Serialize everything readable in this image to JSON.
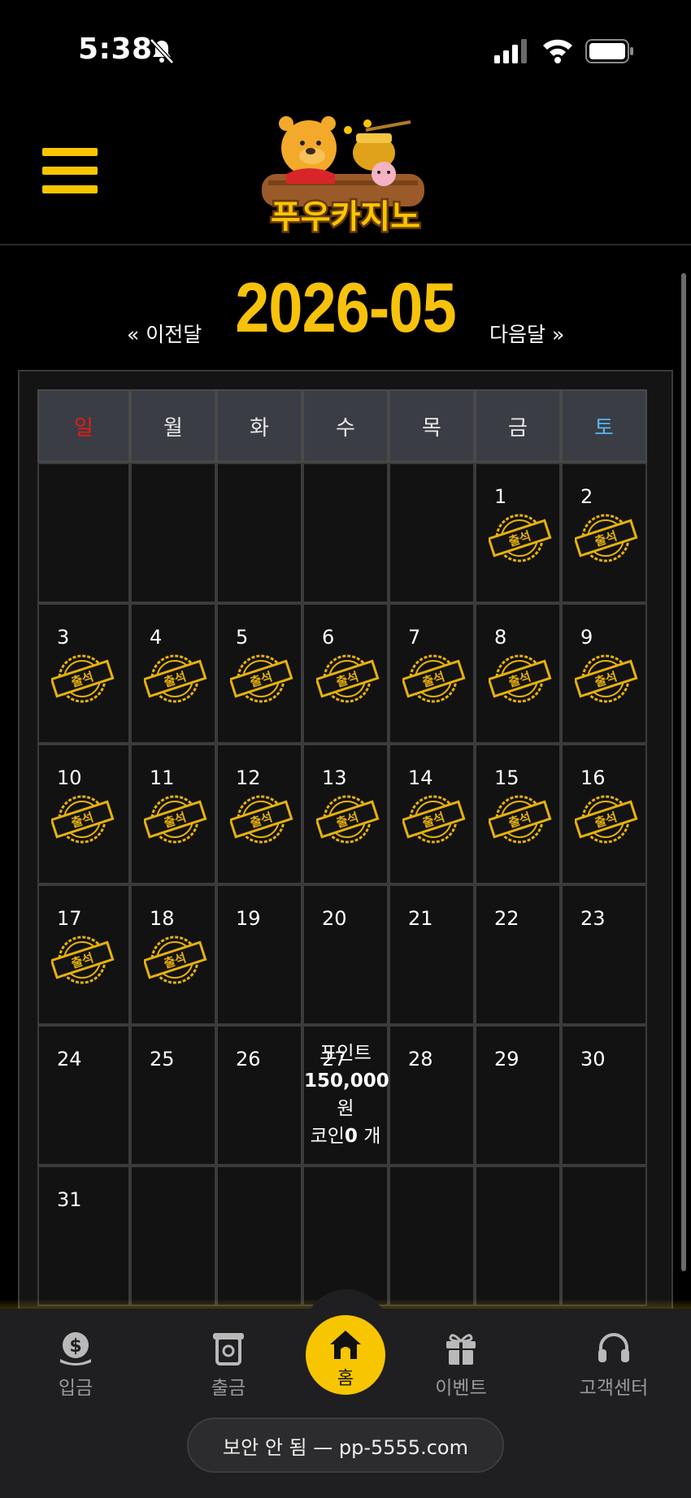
{
  "status_bar": {
    "time": "5:38"
  },
  "header": {
    "logo_text": "푸우카지노"
  },
  "month_nav": {
    "prev": "« 이전달",
    "title": "2026-05",
    "next": "다음달 »"
  },
  "calendar": {
    "weekdays": [
      "일",
      "월",
      "화",
      "수",
      "목",
      "금",
      "토"
    ],
    "weeks": [
      [
        {
          "day": "",
          "stamp": false
        },
        {
          "day": "",
          "stamp": false
        },
        {
          "day": "",
          "stamp": false
        },
        {
          "day": "",
          "stamp": false
        },
        {
          "day": "",
          "stamp": false
        },
        {
          "day": "1",
          "stamp": true
        },
        {
          "day": "2",
          "stamp": true
        }
      ],
      [
        {
          "day": "3",
          "stamp": true
        },
        {
          "day": "4",
          "stamp": true
        },
        {
          "day": "5",
          "stamp": true
        },
        {
          "day": "6",
          "stamp": true
        },
        {
          "day": "7",
          "stamp": true
        },
        {
          "day": "8",
          "stamp": true
        },
        {
          "day": "9",
          "stamp": true
        }
      ],
      [
        {
          "day": "10",
          "stamp": true
        },
        {
          "day": "11",
          "stamp": true
        },
        {
          "day": "12",
          "stamp": true
        },
        {
          "day": "13",
          "stamp": true
        },
        {
          "day": "14",
          "stamp": true
        },
        {
          "day": "15",
          "stamp": true
        },
        {
          "day": "16",
          "stamp": true
        }
      ],
      [
        {
          "day": "17",
          "stamp": true
        },
        {
          "day": "18",
          "stamp": true
        },
        {
          "day": "19",
          "stamp": false
        },
        {
          "day": "20",
          "stamp": false
        },
        {
          "day": "21",
          "stamp": false
        },
        {
          "day": "22",
          "stamp": false
        },
        {
          "day": "23",
          "stamp": false
        }
      ],
      [
        {
          "day": "24",
          "stamp": false
        },
        {
          "day": "25",
          "stamp": false
        },
        {
          "day": "26",
          "stamp": false
        },
        {
          "day": "27",
          "stamp": false
        },
        {
          "day": "28",
          "stamp": false
        },
        {
          "day": "29",
          "stamp": false
        },
        {
          "day": "30",
          "stamp": false
        }
      ],
      [
        {
          "day": "31",
          "stamp": false
        },
        {
          "day": "",
          "stamp": false
        },
        {
          "day": "",
          "stamp": false
        },
        {
          "day": "",
          "stamp": false
        },
        {
          "day": "",
          "stamp": false
        },
        {
          "day": "",
          "stamp": false
        },
        {
          "day": "",
          "stamp": false
        }
      ]
    ],
    "stamp_text": "출석",
    "point_overlay": {
      "line1": "포인트",
      "amount": "150,000",
      "unit": "원",
      "coin_label": "코인",
      "coin_count": "0",
      "coin_unit": " 개"
    }
  },
  "bottom_nav": {
    "items": [
      {
        "label": "입금",
        "icon": "deposit-icon"
      },
      {
        "label": "출금",
        "icon": "withdraw-icon"
      },
      {
        "label": "홈",
        "icon": "home-icon"
      },
      {
        "label": "이벤트",
        "icon": "gift-icon"
      },
      {
        "label": "고객센터",
        "icon": "headset-icon"
      }
    ]
  },
  "url_bar": {
    "text": "보안 안 됨 — pp-5555.com"
  },
  "colors": {
    "accent": "#f7c600",
    "sunday": "#e41b1b",
    "saturday": "#56b4f0"
  }
}
